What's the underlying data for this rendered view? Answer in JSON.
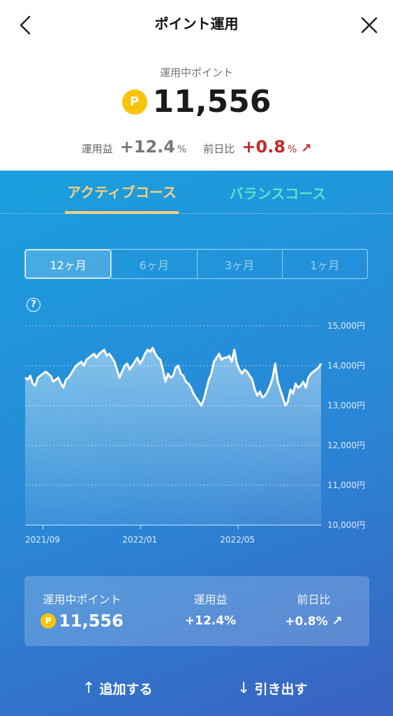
{
  "header": {
    "title": "ポイント運用"
  },
  "summary": {
    "label": "運用中ポイント",
    "coin": "P",
    "amount": "11,556",
    "profit_label": "運用益",
    "profit_value": "+12.4",
    "profit_unit": "%",
    "daily_label": "前日比",
    "daily_value": "+0.8",
    "daily_unit": "%"
  },
  "tabs": {
    "active": "アクティブコース",
    "inactive": "バランスコース"
  },
  "periods": [
    "12ヶ月",
    "6ヶ月",
    "3ヶ月",
    "1ヶ月"
  ],
  "help": "?",
  "chart_data": {
    "type": "area",
    "y_ticks": [
      "15,000円",
      "14,000円",
      "13,000円",
      "12,000円",
      "11,000円",
      "10,000円"
    ],
    "ylim": [
      10000,
      15000
    ],
    "x_ticks": [
      {
        "label": "2021/09",
        "at": 0.06
      },
      {
        "label": "2022/01",
        "at": 0.39
      },
      {
        "label": "2022/05",
        "at": 0.72
      }
    ],
    "values": [
      13700,
      13650,
      13750,
      13550,
      13500,
      13700,
      13750,
      13800,
      13850,
      13800,
      13750,
      13600,
      13650,
      13700,
      13550,
      13450,
      13650,
      13700,
      13800,
      13900,
      14000,
      14050,
      14100,
      14000,
      14150,
      14200,
      14250,
      14300,
      14200,
      14300,
      14350,
      14400,
      14250,
      14300,
      14200,
      14100,
      13900,
      13700,
      13850,
      14000,
      14050,
      13900,
      14000,
      14100,
      14200,
      14050,
      14150,
      14300,
      14400,
      14350,
      14450,
      14300,
      14200,
      14150,
      13900,
      13600,
      13800,
      13700,
      13750,
      13950,
      14000,
      13800,
      13750,
      13600,
      13550,
      13450,
      13300,
      13200,
      13100,
      13000,
      13150,
      13400,
      13650,
      13800,
      14100,
      14200,
      14300,
      14150,
      14200,
      14200,
      14250,
      14100,
      14400,
      14050,
      13900,
      13800,
      13900,
      13850,
      13750,
      13650,
      13400,
      13250,
      13350,
      13200,
      13250,
      13350,
      13500,
      13700,
      14050,
      13600,
      13400,
      13200,
      13000,
      13100,
      13400,
      13300,
      13550,
      13450,
      13500,
      13600,
      13450,
      13700,
      13800,
      13850,
      13900,
      13950,
      14050
    ]
  },
  "bottom": {
    "points_label": "運用中ポイント",
    "coin": "P",
    "points_value": "11,556",
    "profit_label": "運用益",
    "profit_value": "+12.4%",
    "daily_label": "前日比",
    "daily_value": "+0.8%"
  },
  "actions": {
    "add": "追加する",
    "withdraw": "引き出す"
  },
  "colors": {
    "panel_top": "#1aa0de",
    "panel_bottom": "#3a62c0",
    "active_tab": "#f6cf7e",
    "inactive_tab": "#55e4c7",
    "negative_red": "#c62828",
    "coin": "#f8c40a"
  }
}
